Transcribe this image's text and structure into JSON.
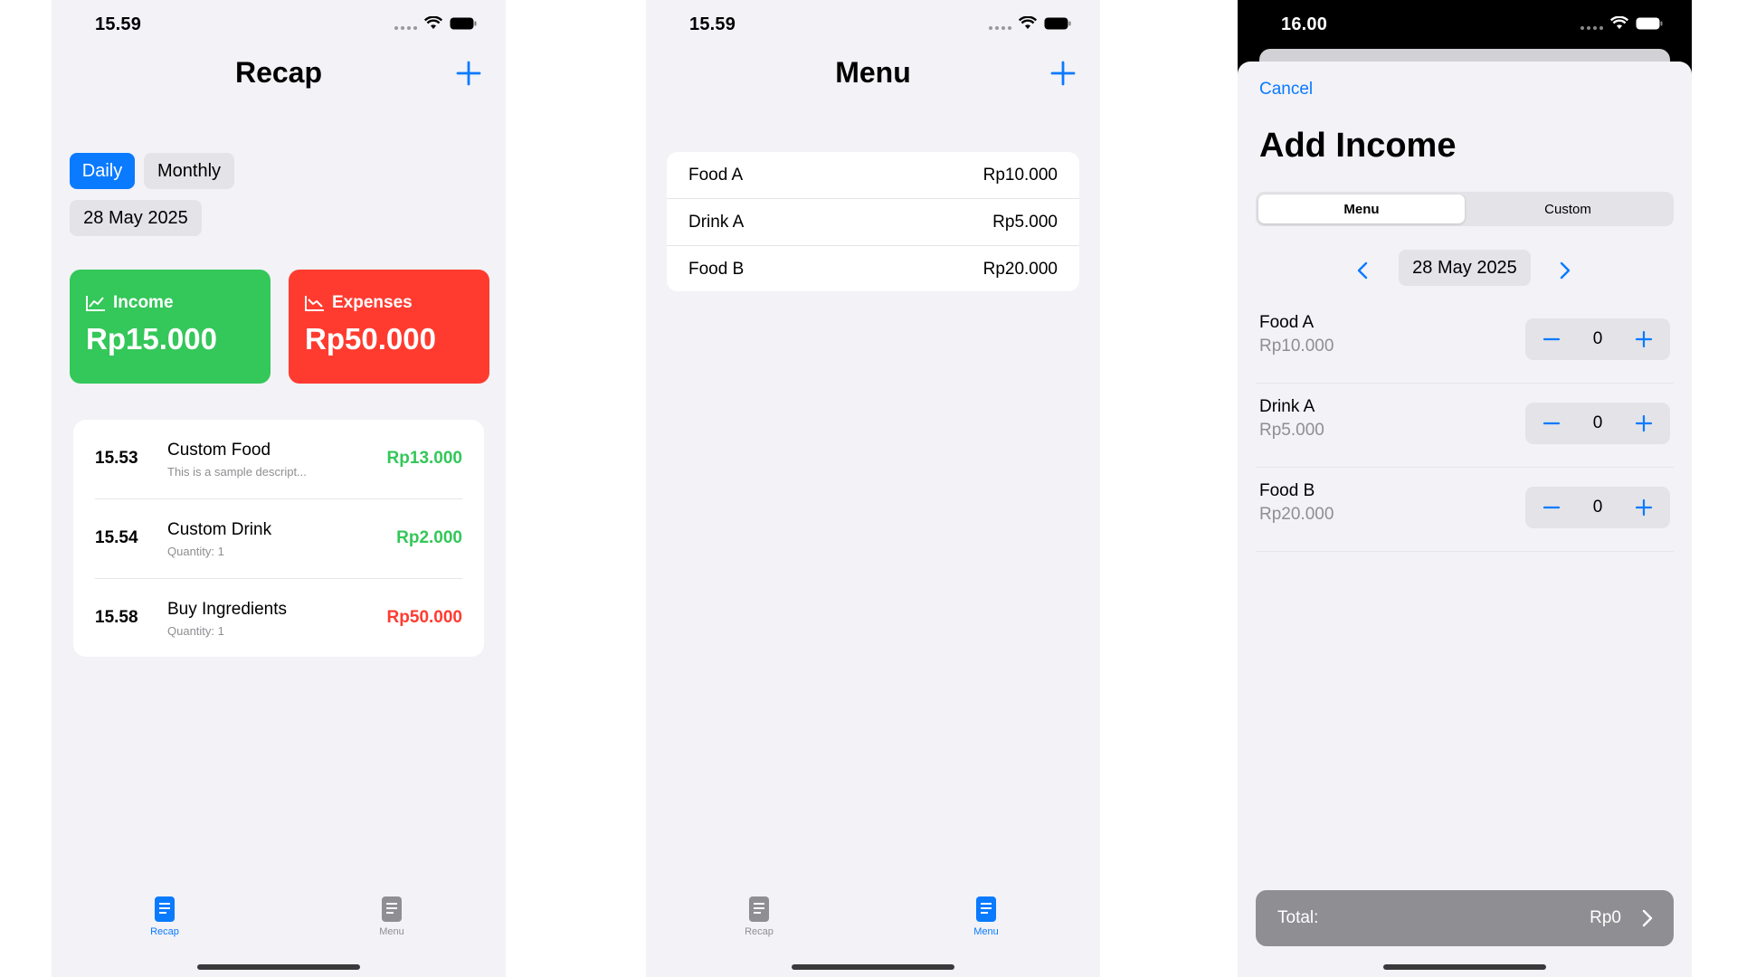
{
  "colors": {
    "accent": "#0a7aff",
    "income": "#34c759",
    "expense": "#ff3b30",
    "background": "#f2f2f7"
  },
  "recap": {
    "status_time": "15.59",
    "title": "Recap",
    "filters": [
      {
        "label": "Daily",
        "active": true
      },
      {
        "label": "Monthly",
        "active": false
      }
    ],
    "date": "28 May 2025",
    "income": {
      "label": "Income",
      "amount": "Rp15.000",
      "icon": "chart-up-icon"
    },
    "expenses": {
      "label": "Expenses",
      "amount": "Rp50.000",
      "icon": "chart-down-icon"
    },
    "transactions": [
      {
        "time": "15.53",
        "name": "Custom Food",
        "subtitle": "This is a sample descript...",
        "amount": "Rp13.000",
        "type": "income"
      },
      {
        "time": "15.54",
        "name": "Custom Drink",
        "subtitle": "Quantity: 1",
        "amount": "Rp2.000",
        "type": "income"
      },
      {
        "time": "15.58",
        "name": "Buy Ingredients",
        "subtitle": "Quantity: 1",
        "amount": "Rp50.000",
        "type": "expense"
      }
    ],
    "tabs": [
      {
        "label": "Recap",
        "active": true
      },
      {
        "label": "Menu",
        "active": false
      }
    ]
  },
  "menu": {
    "status_time": "15.59",
    "title": "Menu",
    "items": [
      {
        "name": "Food A",
        "price": "Rp10.000"
      },
      {
        "name": "Drink A",
        "price": "Rp5.000"
      },
      {
        "name": "Food B",
        "price": "Rp20.000"
      }
    ],
    "tabs": [
      {
        "label": "Recap",
        "active": false
      },
      {
        "label": "Menu",
        "active": true
      }
    ]
  },
  "add_income": {
    "status_time": "16.00",
    "cancel_label": "Cancel",
    "title": "Add Income",
    "segments": [
      {
        "label": "Menu",
        "selected": true
      },
      {
        "label": "Custom",
        "selected": false
      }
    ],
    "date": "28 May 2025",
    "items": [
      {
        "name": "Food A",
        "price": "Rp10.000",
        "qty": "0"
      },
      {
        "name": "Drink A",
        "price": "Rp5.000",
        "qty": "0"
      },
      {
        "name": "Food B",
        "price": "Rp20.000",
        "qty": "0"
      }
    ],
    "total_label": "Total:",
    "total_value": "Rp0"
  }
}
